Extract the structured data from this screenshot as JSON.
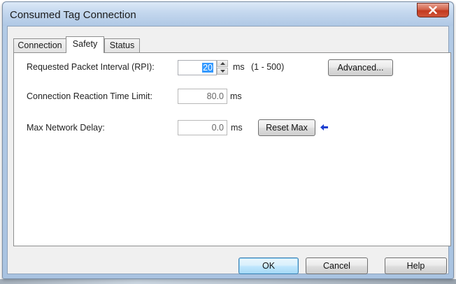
{
  "window": {
    "title": "Consumed Tag Connection"
  },
  "tabs": [
    {
      "label": "Connection",
      "active": false
    },
    {
      "label": "Safety",
      "active": true
    },
    {
      "label": "Status",
      "active": false
    }
  ],
  "safety": {
    "rpi_label": "Requested Packet Interval (RPI):",
    "rpi_value": "20",
    "rpi_unit": "ms",
    "rpi_range": "(1 - 500)",
    "advanced_button": "Advanced...",
    "reaction_label": "Connection Reaction Time Limit:",
    "reaction_value": "80.0",
    "reaction_unit": "ms",
    "delay_label": "Max Network Delay:",
    "delay_value": "0.0",
    "delay_unit": "ms",
    "reset_button": "Reset Max"
  },
  "footer": {
    "ok_button": "OK",
    "cancel_button": "Cancel",
    "help_button": "Help"
  },
  "colors": {
    "pointer_arrow": "#1b3fd0",
    "close_button": "#c8452b"
  },
  "icons": {
    "close": "close-icon",
    "spin_up": "spin-up-icon",
    "spin_down": "spin-down-icon",
    "pointer": "left-arrow-icon"
  }
}
